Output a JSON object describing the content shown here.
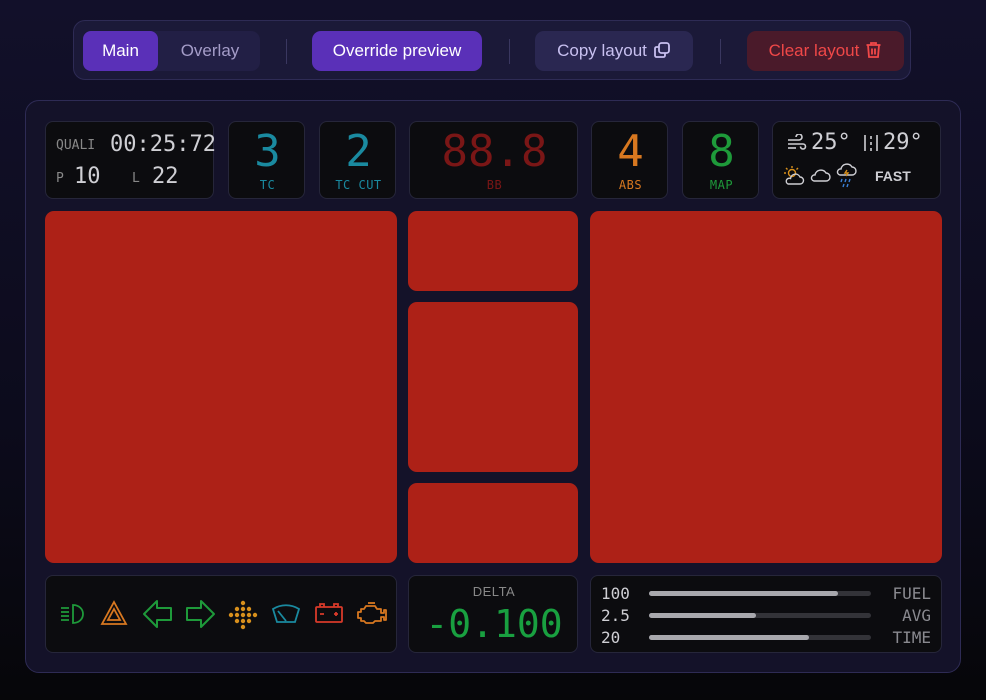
{
  "toolbar": {
    "tab_main": "Main",
    "tab_overlay": "Overlay",
    "override_label": "Override preview",
    "copy_label": "Copy layout",
    "clear_label": "Clear layout"
  },
  "session": {
    "mode": "QUALI",
    "time": "00:25:72",
    "pos_label": "P",
    "pos_value": "10",
    "lap_label": "L",
    "lap_value": "22"
  },
  "tc": {
    "value": "3",
    "label": "TC",
    "color": "#1a8aa0"
  },
  "tc_cut": {
    "value": "2",
    "label": "TC CUT",
    "color": "#1a8aa0"
  },
  "bb": {
    "value": "88.8",
    "label": "BB",
    "color": "#7a1616"
  },
  "abs": {
    "value": "4",
    "label": "ABS",
    "color": "#d87820"
  },
  "map": {
    "value": "8",
    "label": "MAP",
    "color": "#1e9a3a"
  },
  "weather": {
    "air_temp": "25°",
    "track_temp": "29°",
    "track_state": "FAST"
  },
  "delta": {
    "label": "DELTA",
    "value": "-0.100",
    "color": "#19a040"
  },
  "fuel_bars": [
    {
      "value": "100",
      "label": "FUEL",
      "fill": 0.85
    },
    {
      "value": "2.5",
      "label": "AVG",
      "fill": 0.48
    },
    {
      "value": "20",
      "label": "TIME",
      "fill": 0.72
    }
  ],
  "indicators": [
    {
      "icon": "headlight-icon",
      "color": "#1e9a3a"
    },
    {
      "icon": "hazard-icon",
      "color": "#d87820"
    },
    {
      "icon": "arrow-left-icon",
      "color": "#1e9a3a"
    },
    {
      "icon": "arrow-right-icon",
      "color": "#1e9a3a"
    },
    {
      "icon": "dots-icon",
      "color": "#d8901c"
    },
    {
      "icon": "wiper-icon",
      "color": "#1a8aa0"
    },
    {
      "icon": "battery-icon",
      "color": "#d83a2a"
    },
    {
      "icon": "engine-icon",
      "color": "#d87820"
    }
  ]
}
